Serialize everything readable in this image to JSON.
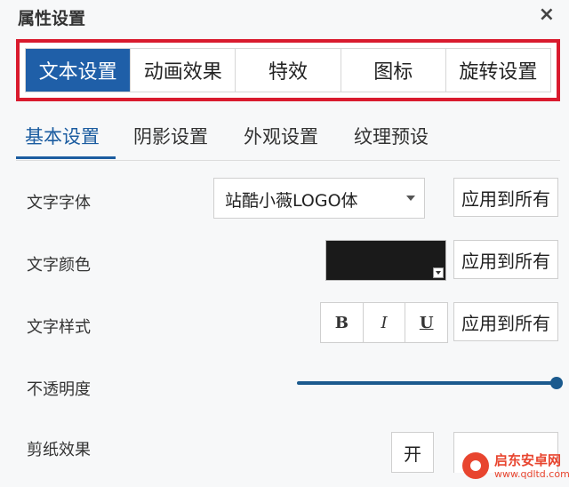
{
  "window": {
    "title": "属性设置",
    "close_glyph": "×"
  },
  "main_tabs": [
    {
      "label": "文本设置",
      "active": true
    },
    {
      "label": "动画效果",
      "active": false
    },
    {
      "label": "特效",
      "active": false
    },
    {
      "label": "图标",
      "active": false
    },
    {
      "label": "旋转设置",
      "active": false
    }
  ],
  "sub_tabs": [
    {
      "label": "基本设置",
      "active": true
    },
    {
      "label": "阴影设置",
      "active": false
    },
    {
      "label": "外观设置",
      "active": false
    },
    {
      "label": "纹理预设",
      "active": false
    }
  ],
  "rows": {
    "font": {
      "label": "文字字体",
      "value": "站酷小薇LOGO体",
      "apply": "应用到所有"
    },
    "color": {
      "label": "文字颜色",
      "value_color": "#1a1a1a",
      "apply": "应用到所有"
    },
    "style": {
      "label": "文字样式",
      "bold": "B",
      "italic": "I",
      "underline": "U",
      "apply": "应用到所有"
    },
    "opacity": {
      "label": "不透明度",
      "value_fraction": 1.0
    },
    "clip": {
      "label": "剪纸效果",
      "on_label": "开"
    }
  },
  "watermark": {
    "name": "启东安卓网",
    "url": "www.qdltd.com"
  },
  "colors": {
    "accent_blue": "#1f5fa8",
    "highlight_red": "#d91b2e",
    "slider_blue": "#1b5a8e"
  }
}
